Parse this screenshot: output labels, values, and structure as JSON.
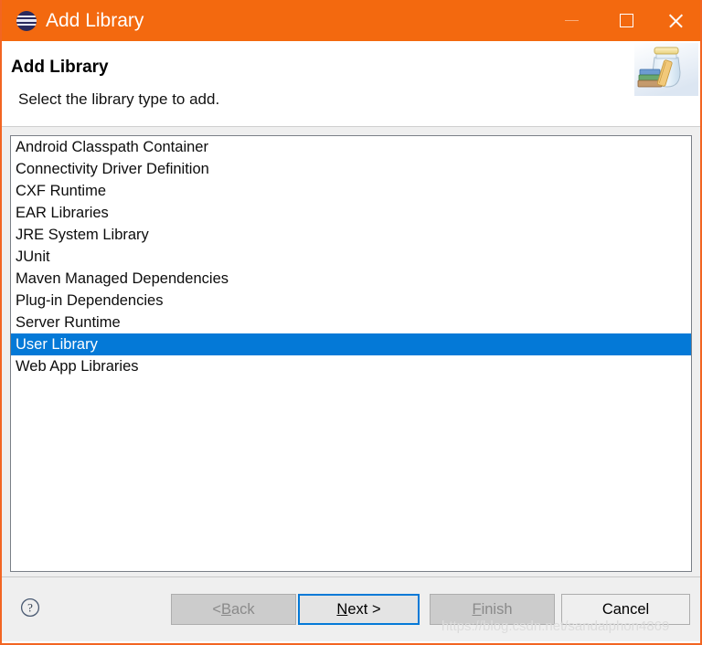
{
  "titlebar": {
    "title": "Add Library",
    "app_icon": "eclipse-icon",
    "minimize_label": "Minimize",
    "maximize_label": "Maximize",
    "close_label": "Close",
    "background_color": "#F3690F"
  },
  "header": {
    "title": "Add Library",
    "subtitle": "Select the library type to add.",
    "banner_icon": "library-jar-books-icon"
  },
  "list": {
    "selected_index": 9,
    "selection_color": "#0479D7",
    "items": [
      "Android Classpath Container",
      "Connectivity Driver Definition",
      "CXF Runtime",
      "EAR Libraries",
      "JRE System Library",
      "JUnit",
      "Maven Managed Dependencies",
      "Plug-in Dependencies",
      "Server Runtime",
      "User Library",
      "Web App Libraries"
    ]
  },
  "footer": {
    "help_icon": "question-mark-icon",
    "buttons": [
      {
        "id": "back",
        "label_prefix": "< ",
        "mnemonic": "B",
        "label_suffix": "ack",
        "state": "disabled"
      },
      {
        "id": "next",
        "label_prefix": "",
        "mnemonic": "N",
        "label_suffix": "ext >",
        "state": "focused"
      },
      {
        "id": "finish",
        "label_prefix": "",
        "mnemonic": "F",
        "label_suffix": "inish",
        "state": "disabled"
      },
      {
        "id": "cancel",
        "label_prefix": "",
        "mnemonic": "",
        "label_suffix": "Cancel",
        "state": "enabled"
      }
    ]
  },
  "watermark": {
    "text": "https://blog.csdn.net/sandalphon4869"
  }
}
